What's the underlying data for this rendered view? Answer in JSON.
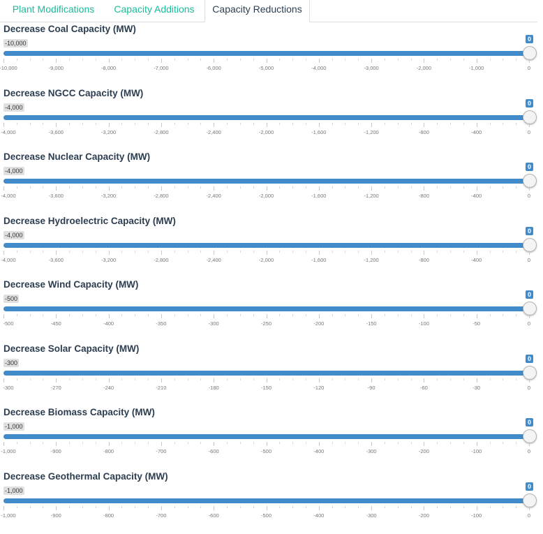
{
  "tabs": [
    {
      "label": "Plant Modifications",
      "active": false
    },
    {
      "label": "Capacity Additions",
      "active": false
    },
    {
      "label": "Capacity Reductions",
      "active": true
    }
  ],
  "colors": {
    "accent_tab": "#18bc9c",
    "slider_bar": "#428bca",
    "active_text": "#2c3e50"
  },
  "sliders": [
    {
      "label": "Decrease Coal Capacity (MW)",
      "min": -10000,
      "max": 0,
      "value": 0,
      "min_label": "-10,000",
      "max_label": "0",
      "ticks": [
        "-10,000",
        "-9,000",
        "-8,000",
        "-7,000",
        "-6,000",
        "-5,000",
        "-4,000",
        "-3,000",
        "-2,000",
        "-1,000",
        "0"
      ]
    },
    {
      "label": "Decrease NGCC Capacity (MW)",
      "min": -4000,
      "max": 0,
      "value": 0,
      "min_label": "-4,000",
      "max_label": "0",
      "ticks": [
        "-4,000",
        "-3,600",
        "-3,200",
        "-2,800",
        "-2,400",
        "-2,000",
        "-1,600",
        "-1,200",
        "-800",
        "-400",
        "0"
      ]
    },
    {
      "label": "Decrease Nuclear Capacity (MW)",
      "min": -4000,
      "max": 0,
      "value": 0,
      "min_label": "-4,000",
      "max_label": "0",
      "ticks": [
        "-4,000",
        "-3,600",
        "-3,200",
        "-2,800",
        "-2,400",
        "-2,000",
        "-1,600",
        "-1,200",
        "-800",
        "-400",
        "0"
      ]
    },
    {
      "label": "Decrease Hydroelectric Capacity (MW)",
      "min": -4000,
      "max": 0,
      "value": 0,
      "min_label": "-4,000",
      "max_label": "0",
      "ticks": [
        "-4,000",
        "-3,600",
        "-3,200",
        "-2,800",
        "-2,400",
        "-2,000",
        "-1,600",
        "-1,200",
        "-800",
        "-400",
        "0"
      ]
    },
    {
      "label": "Decrease Wind Capacity (MW)",
      "min": -500,
      "max": 0,
      "value": 0,
      "min_label": "-500",
      "max_label": "0",
      "ticks": [
        "-500",
        "-450",
        "-400",
        "-350",
        "-300",
        "-250",
        "-200",
        "-150",
        "-100",
        "-50",
        "0"
      ]
    },
    {
      "label": "Decrease Solar Capacity (MW)",
      "min": -300,
      "max": 0,
      "value": 0,
      "min_label": "-300",
      "max_label": "0",
      "ticks": [
        "-300",
        "-270",
        "-240",
        "-210",
        "-180",
        "-150",
        "-120",
        "-90",
        "-60",
        "-30",
        "0"
      ]
    },
    {
      "label": "Decrease Biomass Capacity (MW)",
      "min": -1000,
      "max": 0,
      "value": 0,
      "min_label": "-1,000",
      "max_label": "0",
      "ticks": [
        "-1,000",
        "-900",
        "-800",
        "-700",
        "-600",
        "-500",
        "-400",
        "-300",
        "-200",
        "-100",
        "0"
      ]
    },
    {
      "label": "Decrease Geothermal Capacity (MW)",
      "min": -1000,
      "max": 0,
      "value": 0,
      "min_label": "-1,000",
      "max_label": "0",
      "ticks": [
        "-1,000",
        "-900",
        "-800",
        "-700",
        "-600",
        "-500",
        "-400",
        "-300",
        "-200",
        "-100",
        "0"
      ]
    }
  ]
}
